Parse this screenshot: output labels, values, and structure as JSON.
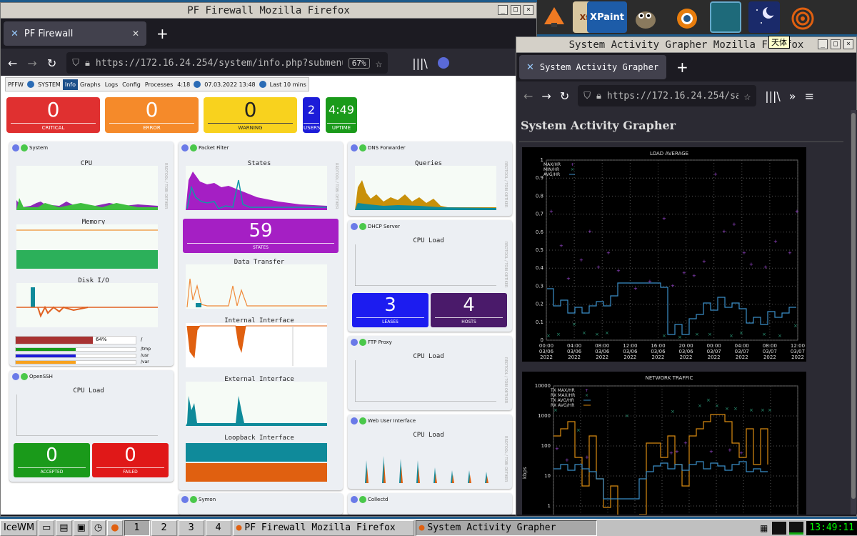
{
  "desktop": {
    "launcher": [
      {
        "label": "Inkscape",
        "color": "#f07a22"
      },
      {
        "label": "Xfig",
        "color": "#7a4a2a"
      },
      {
        "label": "XPaint",
        "color": "#1d5ca8"
      },
      {
        "label": "GIMP",
        "color": "#6b5a3e"
      },
      {
        "label": "Blender",
        "color": "#e87d0d"
      },
      {
        "label": "Term",
        "color": "#1e6a7a"
      },
      {
        "label": "Stellarium",
        "color": "#1a2a6a"
      },
      {
        "label": "Grapher",
        "color": "#e06010"
      }
    ],
    "launcher_names": {
      "xfig": "Xfig",
      "xpaint": "XPaint"
    },
    "tooltip": "天体"
  },
  "pf_window": {
    "title": "PF Firewall  Mozilla Firefox",
    "tab_title": "PF Firewall",
    "url": "https://172.16.24.254/system/info.php?submenu=dashboard",
    "zoom": "67%",
    "menu": [
      "PFFW",
      "SYSTEM",
      "Info",
      "Graphs",
      "Logs",
      "Config",
      "Processes",
      "4:18",
      "07.03.2022 13:48",
      "Last 10 mins"
    ],
    "stats": [
      {
        "value": "0",
        "label": "CRITICAL",
        "color": "#e03030"
      },
      {
        "value": "0",
        "label": "ERROR",
        "color": "#f58a2a"
      },
      {
        "value": "0",
        "label": "WARNING",
        "color": "#f8d21e"
      },
      {
        "value": "2",
        "label": "USERS",
        "color": "#1c1cd8"
      },
      {
        "value": "4:49",
        "label": "UPTIME",
        "color": "#1a9a1a"
      }
    ],
    "system_panel": {
      "name": "System",
      "charts": [
        "CPU",
        "Memory",
        "Disk I/O"
      ],
      "disks": [
        {
          "mount": "/",
          "value": "64%",
          "fill": 0.64,
          "color": "#a83232"
        },
        {
          "mount": "/tmp",
          "fill": 0.5,
          "color": "#1a9a1a"
        },
        {
          "mount": "/usr",
          "fill": 0.5,
          "color": "#1c1cd8"
        },
        {
          "mount": "/var",
          "fill": 0.5,
          "color": "#f8a21e"
        }
      ]
    },
    "openssh_panel": {
      "name": "OpenSSH",
      "chart": "CPU Load",
      "tiles": [
        {
          "value": "0",
          "label": "ACCEPTED",
          "color": "#1a9a1a"
        },
        {
          "value": "0",
          "label": "FAILED",
          "color": "#e01818"
        }
      ]
    },
    "pf_panel": {
      "name": "Packet Filter",
      "charts": [
        "States",
        "Data Transfer",
        "Internal Interface",
        "External Interface",
        "Loopback Interface"
      ],
      "states_tile": {
        "value": "59",
        "label": "STATES",
        "color": "#a51fc4"
      }
    },
    "symon_panel": {
      "name": "Symon"
    },
    "dns_panel": {
      "name": "DNS Forwarder",
      "chart": "Queries"
    },
    "dhcp_panel": {
      "name": "DHCP Server",
      "chart": "CPU Load",
      "tiles": [
        {
          "value": "3",
          "label": "LEASES",
          "color": "#1c1cf0"
        },
        {
          "value": "4",
          "label": "HOSTS",
          "color": "#4a1a6a"
        }
      ]
    },
    "ftp_panel": {
      "name": "FTP Proxy",
      "chart": "CPU Load"
    },
    "web_panel": {
      "name": "Web User Interface",
      "chart": "CPU Load"
    },
    "collectd_panel": {
      "name": "Collectd"
    },
    "rrd_label": "RRDTOOL / TOBI OETIKER"
  },
  "grapher_window": {
    "title": "System Activity Grapher  Mozilla Firefox",
    "tab_title": "System Activity Grapher",
    "url": "https://172.16.24.254/sa",
    "heading": "System Activity Grapher",
    "load_chart": {
      "title": "LOAD AVERAGE",
      "legend": [
        "MAX/HR",
        "MIN/HR",
        "AVG/HR"
      ],
      "yticks": [
        "0",
        "0.1",
        "0.2",
        "0.3",
        "0.4",
        "0.5",
        "0.6",
        "0.7",
        "0.8",
        "0.9",
        "1"
      ],
      "xticks": [
        {
          "time": "00:00",
          "date": "03/06",
          "year": "2022"
        },
        {
          "time": "04:00",
          "date": "03/06",
          "year": "2022"
        },
        {
          "time": "08:00",
          "date": "03/06",
          "year": "2022"
        },
        {
          "time": "12:00",
          "date": "03/06",
          "year": "2022"
        },
        {
          "time": "16:00",
          "date": "03/06",
          "year": "2022"
        },
        {
          "time": "20:00",
          "date": "03/06",
          "year": "2022"
        },
        {
          "time": "00:00",
          "date": "03/07",
          "year": "2022"
        },
        {
          "time": "04:00",
          "date": "03/07",
          "year": "2022"
        },
        {
          "time": "08:00",
          "date": "03/07",
          "year": "2022"
        },
        {
          "time": "12:00",
          "date": "03/07",
          "year": "2022"
        }
      ]
    },
    "net_chart": {
      "title": "NETWORK TRAFFIC",
      "legend": [
        "TX MAX/HR",
        "RX MAX/HR",
        "TX AVG/HR",
        "RX AVG/HR"
      ],
      "yticks": [
        "10000",
        "1000",
        "100",
        "10",
        "1"
      ],
      "ylabel": "kbps"
    }
  },
  "taskbar": {
    "start": "IceWM",
    "workspaces": [
      "1",
      "2",
      "3",
      "4"
    ],
    "tasks": [
      "PF Firewall  Mozilla Firefox",
      "System Activity Grapher"
    ],
    "clock": "13:49:11"
  },
  "colors": {
    "firefox_dark": "#1c1b22",
    "firefox_toolbar": "#2b2a33",
    "chart_bg": "#000000"
  }
}
